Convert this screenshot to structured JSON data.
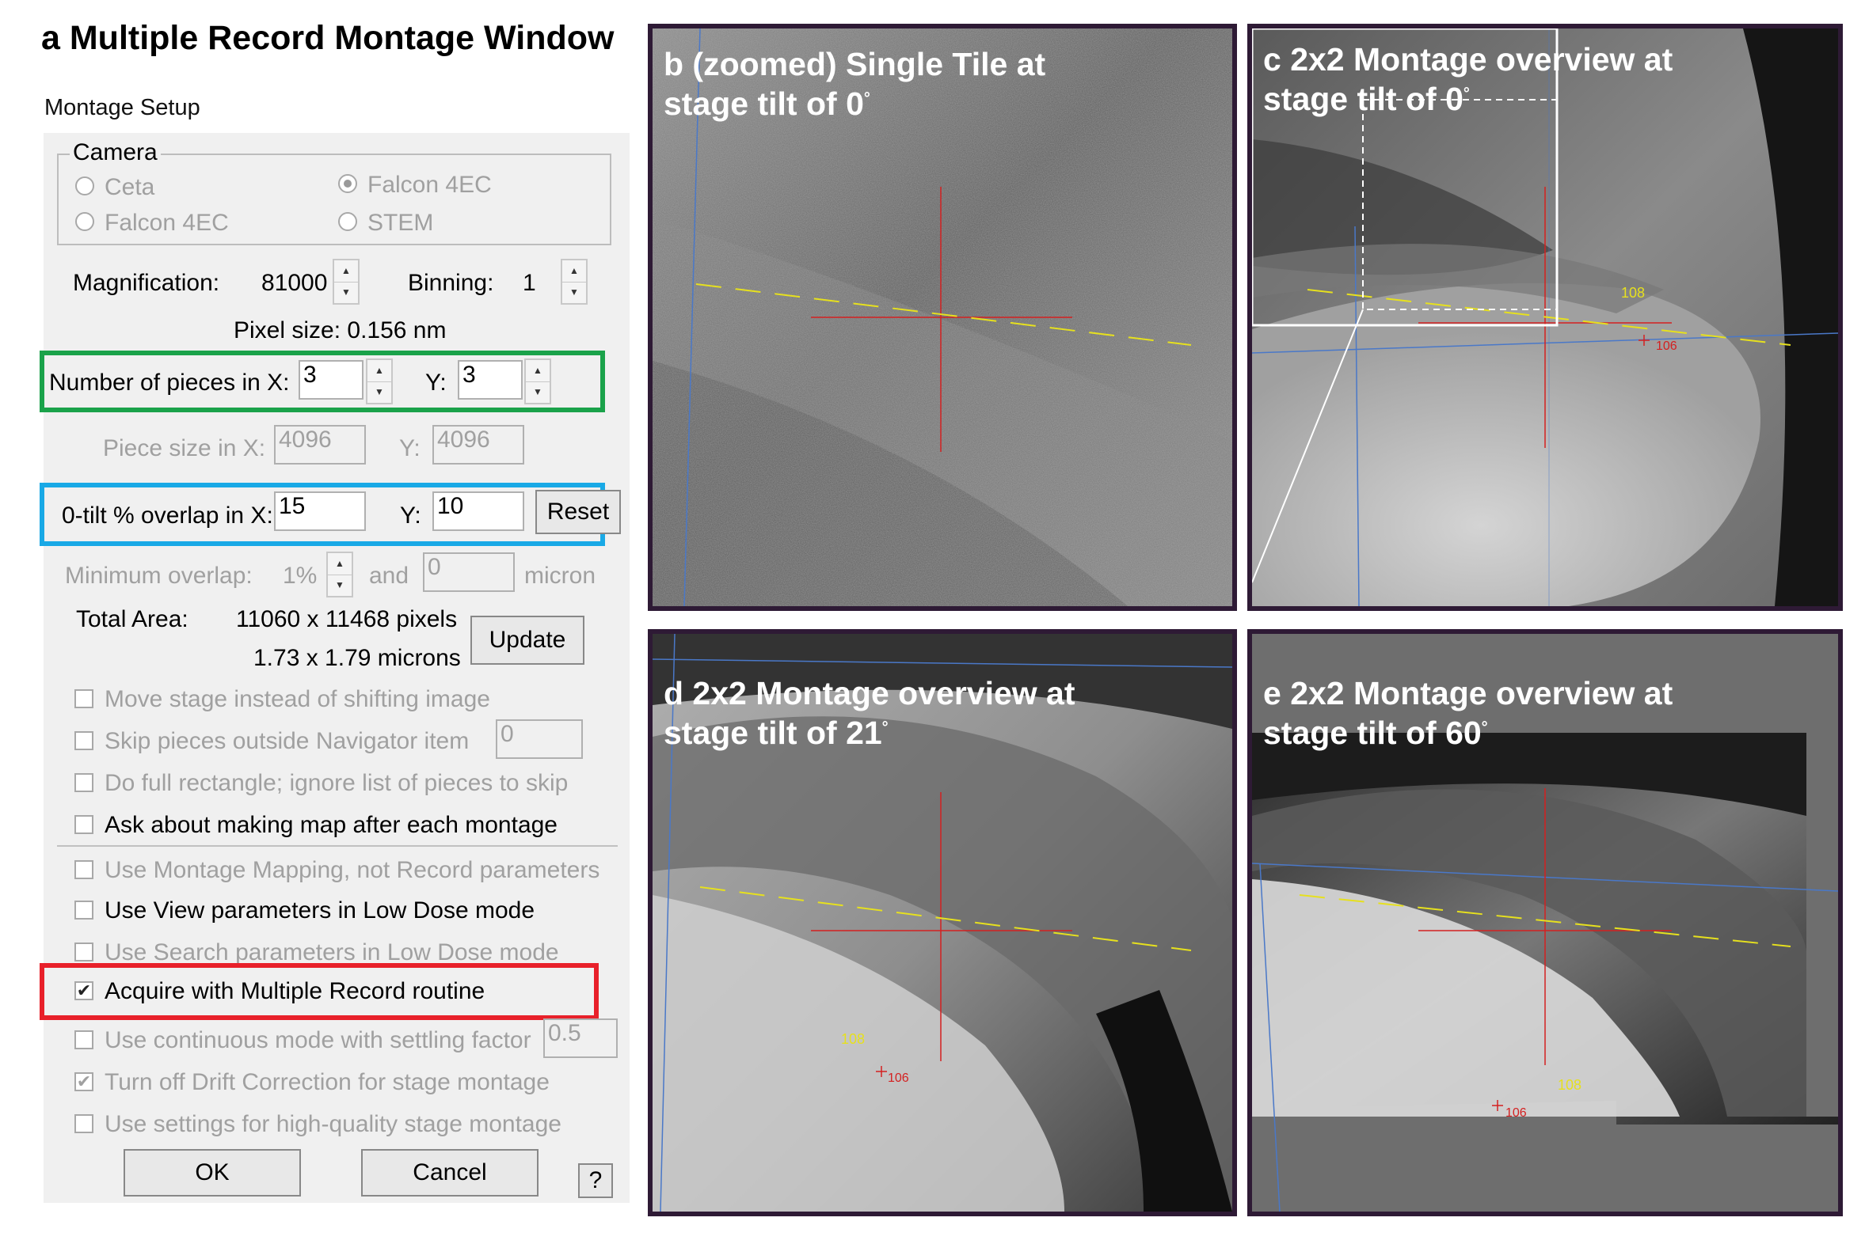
{
  "figure_title": "a Multiple Record Montage Window",
  "dialog": {
    "title": "Montage Setup",
    "camera": {
      "label": "Camera",
      "options": [
        {
          "label": "Ceta",
          "selected": false
        },
        {
          "label": "Falcon 4EC",
          "selected": true
        },
        {
          "label": "Falcon 4EC",
          "selected": false
        },
        {
          "label": "STEM",
          "selected": false
        }
      ]
    },
    "magnification_label": "Magnification:",
    "magnification_value": "81000",
    "binning_label": "Binning:",
    "binning_value": "1",
    "pixel_size": "Pixel size: 0.156 nm",
    "pieces_label": "Number of pieces in X:",
    "pieces_x": "3",
    "pieces_y_label": "Y:",
    "pieces_y": "3",
    "piece_size_label": "Piece size in X:",
    "piece_size_x": "4096",
    "piece_size_y_label": "Y:",
    "piece_size_y": "4096",
    "overlap_label": "0-tilt % overlap in X:",
    "overlap_x": "15",
    "overlap_y_label": "Y:",
    "overlap_y": "10",
    "reset_label": "Reset",
    "min_overlap_label": "Minimum overlap:",
    "min_overlap_value": "1%",
    "and_label": "and",
    "micron_value": "0",
    "micron_label": "micron",
    "total_area_label": "Total Area:",
    "total_pixels": "11060 x 11468 pixels",
    "total_microns": "1.73 x 1.79 microns",
    "update_label": "Update",
    "checkboxes_a": [
      {
        "label": "Move stage instead of shifting image",
        "checked": false,
        "enabled": false
      },
      {
        "label": "Skip pieces outside Navigator item",
        "checked": false,
        "enabled": false
      },
      {
        "label": "Do full rectangle; ignore list of pieces to skip",
        "checked": false,
        "enabled": false
      },
      {
        "label": "Ask about making map after each montage",
        "checked": false,
        "enabled": true
      }
    ],
    "skip_value": "0",
    "checkboxes_b": [
      {
        "label": "Use Montage Mapping, not Record parameters",
        "checked": false,
        "enabled": false
      },
      {
        "label": "Use View parameters in Low Dose mode",
        "checked": false,
        "enabled": true
      },
      {
        "label": "Use Search parameters in Low Dose mode",
        "checked": false,
        "enabled": false
      },
      {
        "label": "Acquire with Multiple Record routine",
        "checked": true,
        "enabled": true
      },
      {
        "label": "Use continuous mode with settling factor",
        "checked": false,
        "enabled": false
      },
      {
        "label": "Turn off Drift Correction for stage montage",
        "checked": true,
        "enabled": false
      },
      {
        "label": "Use settings for high-quality stage montage",
        "checked": false,
        "enabled": false
      }
    ],
    "settling_value": "0.5",
    "ok_label": "OK",
    "cancel_label": "Cancel",
    "help_label": "?",
    "highlight_colors": {
      "pieces": "#1aa24a",
      "overlap": "#19a9e6",
      "multiple_record": "#e8202a"
    }
  },
  "panels": [
    {
      "line1": "b (zoomed) Single Tile at",
      "line2": "stage tilt of 0"
    },
    {
      "line1": "c 2x2 Montage overview at",
      "line2": "stage tilt of 0",
      "labels": [
        "108",
        "106"
      ]
    },
    {
      "line1": "d 2x2 Montage overview at",
      "line2": "stage tilt of 21",
      "labels": [
        "108",
        "106"
      ]
    },
    {
      "line1": "e 2x2 Montage overview at",
      "line2": "stage tilt of 60",
      "labels": [
        "108",
        "106"
      ]
    }
  ],
  "degree_mark": "°",
  "annotation_colors": {
    "cross": "#d42020",
    "axis": "#e6e01e",
    "grid": "#4a78c8"
  }
}
